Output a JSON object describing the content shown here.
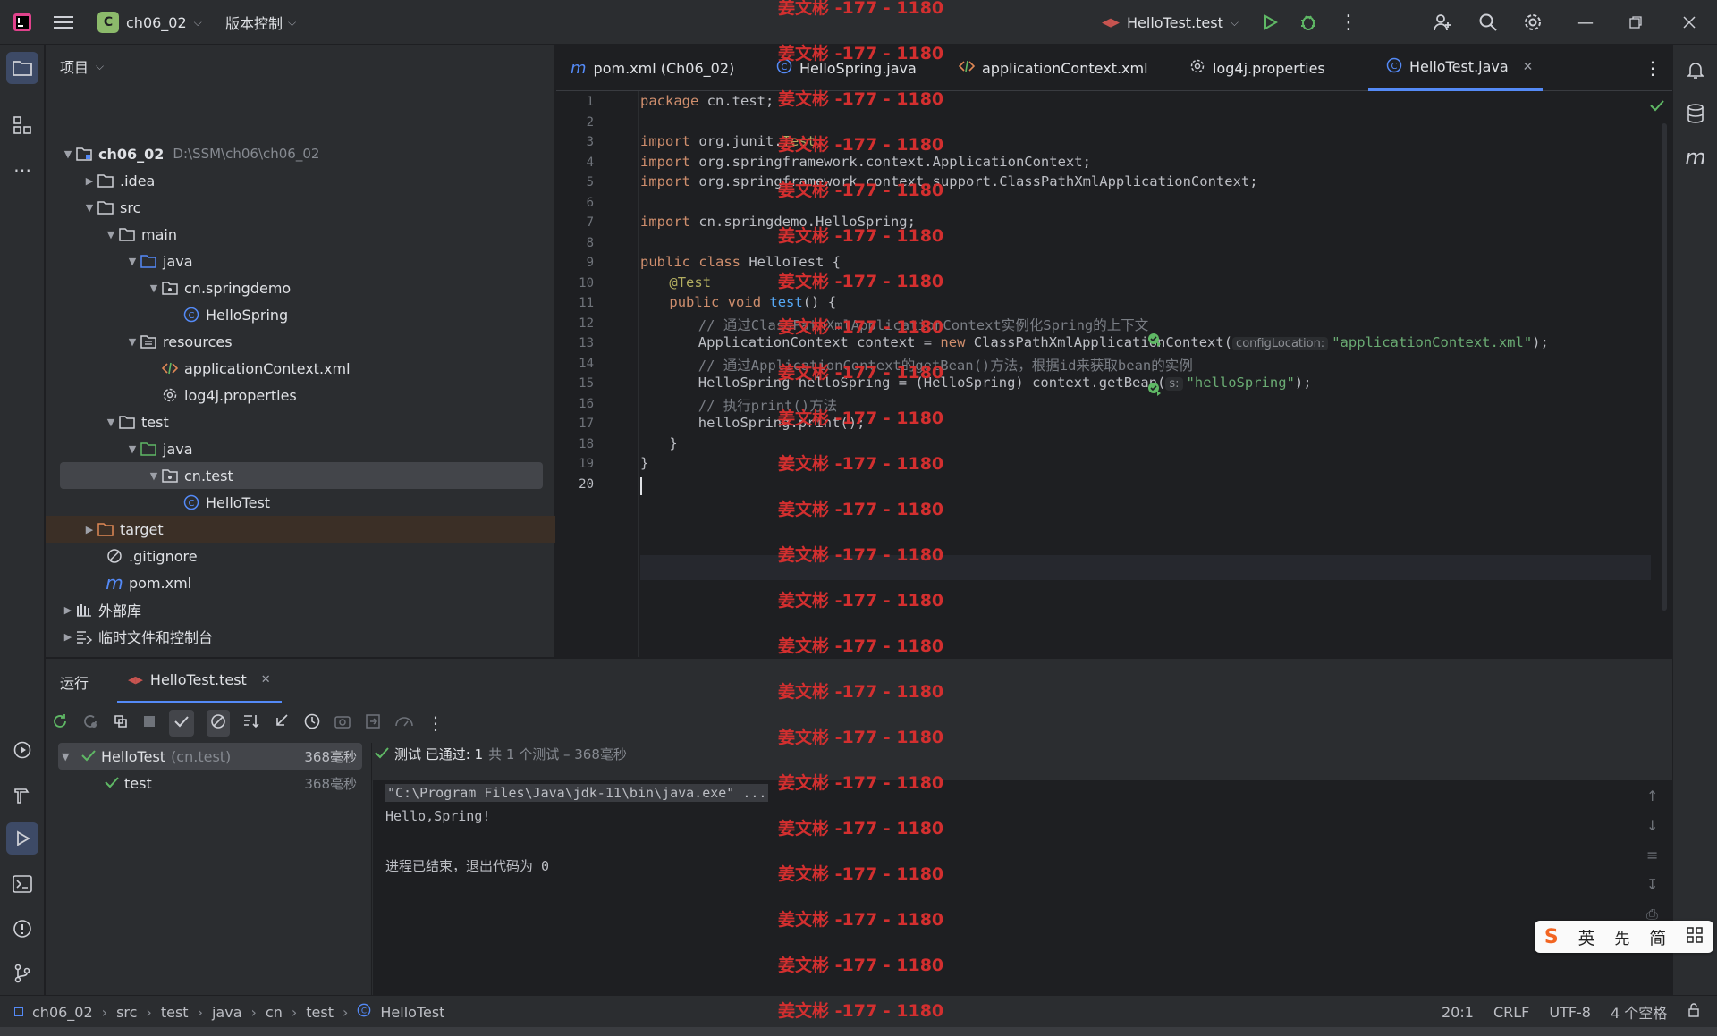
{
  "titlebar": {
    "project_badge": "C",
    "project_name": "ch06_02",
    "vcs_label": "版本控制",
    "run_config": "HelloTest.test"
  },
  "project_panel": {
    "title": "项目",
    "tree": [
      {
        "label": "ch06_02",
        "path": "D:\\SSM\\ch06\\ch06_02"
      },
      {
        "label": ".idea"
      },
      {
        "label": "src"
      },
      {
        "label": "main"
      },
      {
        "label": "java"
      },
      {
        "label": "cn.springdemo"
      },
      {
        "label": "HelloSpring"
      },
      {
        "label": "resources"
      },
      {
        "label": "applicationContext.xml"
      },
      {
        "label": "log4j.properties"
      },
      {
        "label": "test"
      },
      {
        "label": "java"
      },
      {
        "label": "cn.test"
      },
      {
        "label": "HelloTest"
      },
      {
        "label": "target"
      },
      {
        "label": ".gitignore"
      },
      {
        "label": "pom.xml"
      },
      {
        "label": "外部库"
      },
      {
        "label": "临时文件和控制台"
      }
    ]
  },
  "editor": {
    "tabs": [
      {
        "label": "pom.xml (Ch06_02)",
        "icon": "m"
      },
      {
        "label": "HelloSpring.java",
        "icon": "C"
      },
      {
        "label": "applicationContext.xml",
        "icon": "xml"
      },
      {
        "label": "log4j.properties",
        "icon": "gear"
      },
      {
        "label": "HelloTest.java",
        "icon": "C",
        "active": true
      }
    ],
    "line_numbers": [
      "1",
      "2",
      "3",
      "4",
      "5",
      "6",
      "7",
      "8",
      "9",
      "10",
      "11",
      "12",
      "13",
      "14",
      "15",
      "16",
      "17",
      "18",
      "19",
      "20"
    ],
    "code": {
      "l1_kw": "package",
      "l1_rest": " cn.test;",
      "l3_kw": "import",
      "l3_rest": " org.junit.",
      "l3_cls": "Test",
      "l3_end": ";",
      "l4_kw": "import",
      "l4_rest": " org.springframework.context.ApplicationContext;",
      "l5_kw": "import",
      "l5_rest": " org.springframework.context.support.ClassPathXmlApplicationContext;",
      "l7_kw": "import",
      "l7_rest": " cn.springdemo.HelloSpring;",
      "l9_kw": "public class",
      "l9_rest": " HelloTest {",
      "l10_ann": "@Test",
      "l11_kw": "public void",
      "l11_fn": "test",
      "l11_rest": "() {",
      "l12_cm": "// 通过ClassPathXmlApplicationContext实例化Spring的上下文",
      "l13_a": "ApplicationContext context = ",
      "l13_kw": "new",
      "l13_b": " ClassPathXmlApplicationContext(",
      "l13_hint": "configLocation:",
      "l13_str": "\"applicationContext.xml\"",
      "l13_end": ");",
      "l14_cm": "// 通过ApplicationContext的getBean()方法，根据id来获取bean的实例",
      "l15_a": "HelloSpring helloSpring = (HelloSpring) context.getBean(",
      "l15_hint": "s:",
      "l15_str": "\"helloSpring\"",
      "l15_end": ");",
      "l16_cm": "// 执行print()方法",
      "l17": "helloSpring.print();",
      "l18": "}",
      "l19": "}"
    }
  },
  "run_panel": {
    "title": "运行",
    "tab_label": "HelloTest.test",
    "summary_prefix": "测试 已通过: 1",
    "summary_suffix": "共 1 个测试 – 368毫秒",
    "tree": [
      {
        "label": "HelloTest",
        "pkg": "(cn.test)",
        "time": "368毫秒"
      },
      {
        "label": "test",
        "time": "368毫秒"
      }
    ],
    "console": [
      "\"C:\\Program Files\\Java\\jdk-11\\bin\\java.exe\" ...",
      "Hello,Spring!",
      "",
      "进程已结束，退出代码为 0"
    ]
  },
  "statusbar": {
    "breadcrumbs": [
      "ch06_02",
      "src",
      "test",
      "java",
      "cn",
      "test",
      "HelloTest"
    ],
    "position": "20:1",
    "line_ending": "CRLF",
    "encoding": "UTF-8",
    "indent": "4 个空格"
  },
  "watermark": "姜文彬 -177 - 1180",
  "ime": {
    "mode": "英",
    "simplified": "简"
  }
}
